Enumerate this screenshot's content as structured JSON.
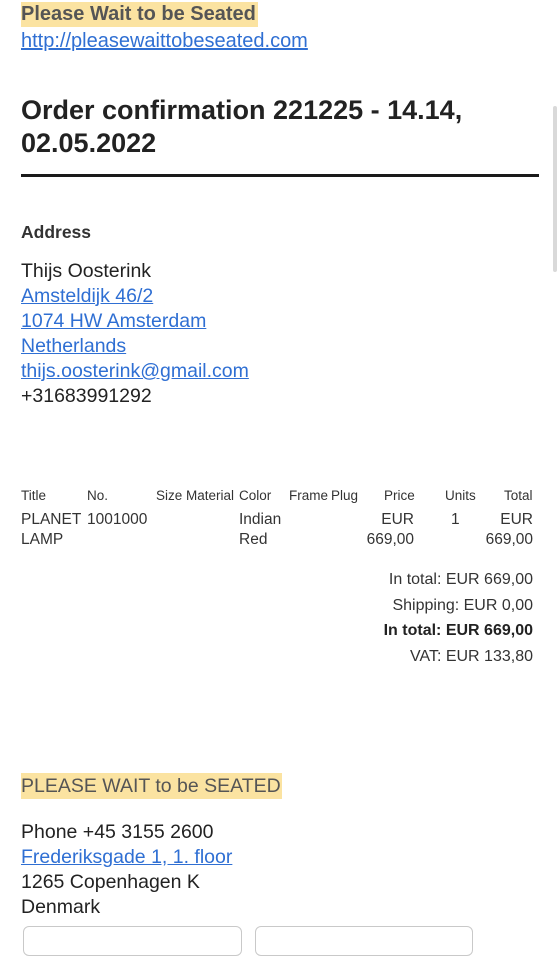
{
  "header": {
    "brand": "Please Wait to be Seated",
    "link": "http://pleasewaittobeseated.com"
  },
  "order": {
    "title": "Order confirmation 221225 - 14.14, 02.05.2022"
  },
  "address": {
    "heading": "Address",
    "name": "Thijs Oosterink",
    "street": "Amsteldijk 46/2",
    "city": "1074 HW Amsterdam",
    "country": "Netherlands",
    "email": "thijs.oosterink@gmail.com",
    "phone": "+31683991292"
  },
  "table": {
    "headers": {
      "title": "Title",
      "no": "No.",
      "size": "Size",
      "material": "Material",
      "color": "Color",
      "frame": "Frame",
      "plug": "Plug",
      "price": "Price",
      "units": "Units",
      "total": "Total"
    },
    "row": {
      "title_line1": "PLANET",
      "title_line2": "LAMP",
      "no": "1001000",
      "color_line1": "Indian",
      "color_line2": "Red",
      "price_line1": "EUR",
      "price_line2": "669,00",
      "units": "1",
      "total_line1": "EUR",
      "total_line2": "669,00"
    }
  },
  "totals": {
    "subtotal": "In total: EUR 669,00",
    "shipping": "Shipping: EUR 0,00",
    "grand_label": "In total:",
    "grand_value": "EUR 669,00",
    "vat": "VAT: EUR 133,80"
  },
  "footer": {
    "brand": "PLEASE WAIT to be SEATED",
    "phone": "Phone +45 3155 2600",
    "street": "Frederiksgade 1, 1. floor",
    "city": "1265 Copenhagen K",
    "country": "Denmark"
  },
  "colors": {
    "highlight": "#fbe3a1",
    "link": "#2f6fd3",
    "text": "#222222"
  }
}
